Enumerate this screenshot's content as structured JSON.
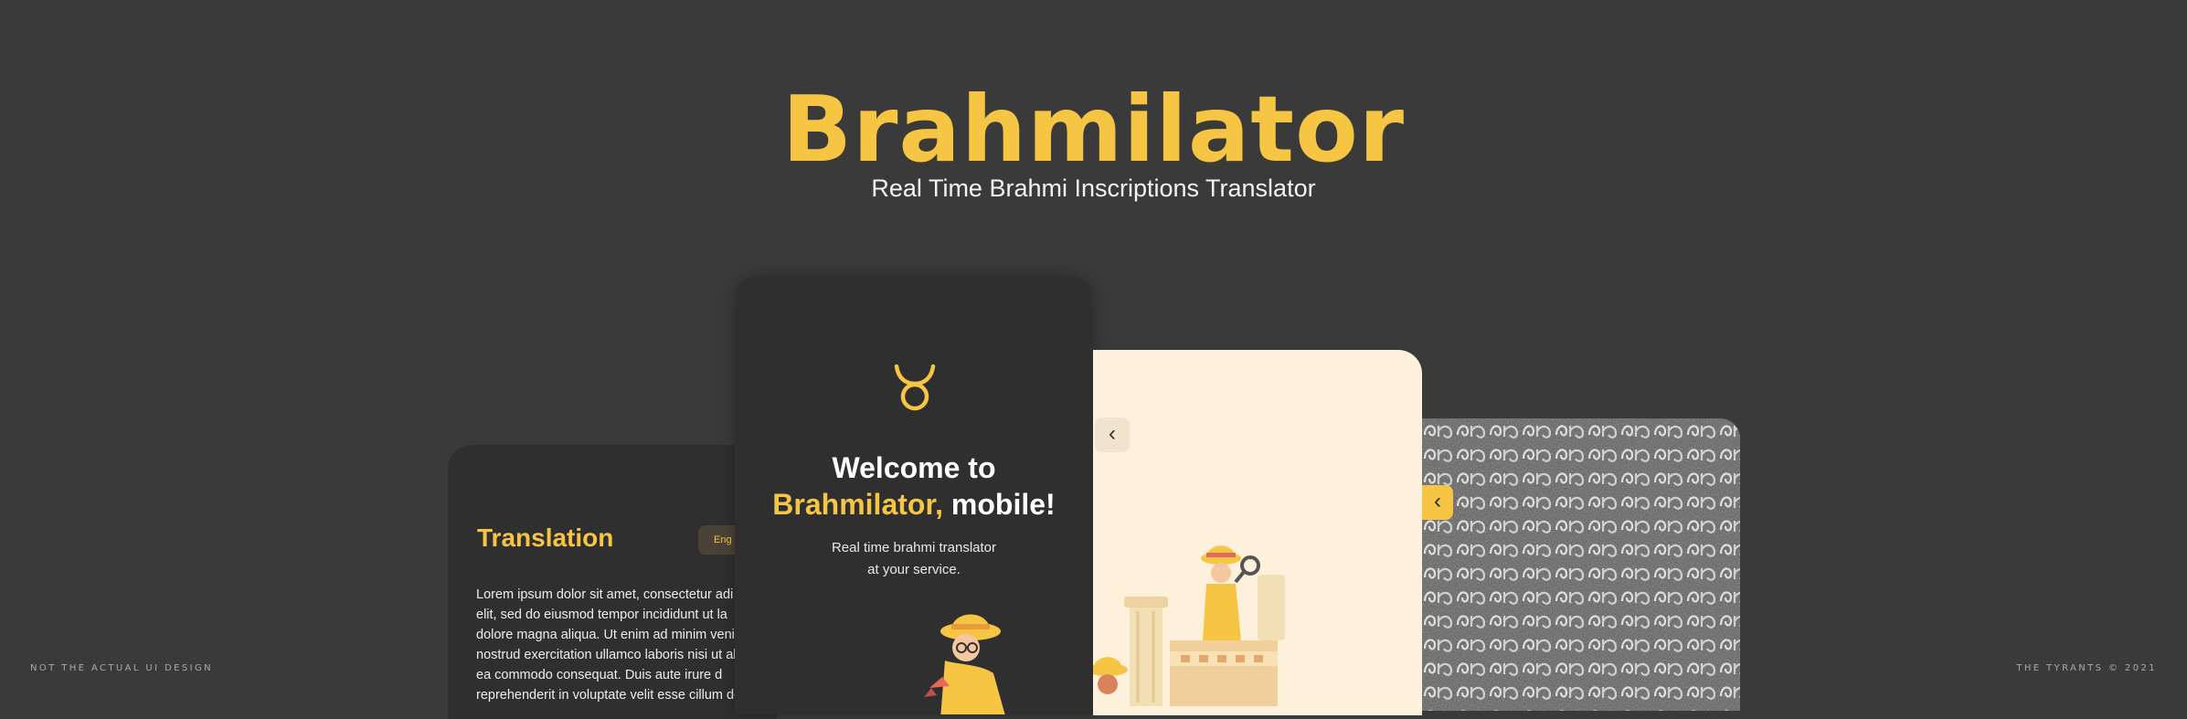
{
  "header": {
    "title": "Brahmilator",
    "subtitle": "Real Time Brahmi Inscriptions Translator"
  },
  "footer": {
    "left_note": "NOT THE ACTUAL UI DESIGN",
    "right_note": "THE TYRANTS © 2021"
  },
  "translation_screen": {
    "title": "Translation",
    "language_chip": "Eng",
    "body": "Lorem ipsum dolor sit amet, consectetur adi\nelit, sed do eiusmod tempor incididunt ut la\ndolore magna aliqua. Ut enim ad minim venia\nnostrud exercitation ullamco laboris nisi ut ali\nea commodo consequat. Duis aute irure d\nreprehenderit in voluptate velit esse cillum do"
  },
  "welcome_screen": {
    "title_line1": "Welcome to",
    "title_accent": "Brahmilator,",
    "title_rest": " mobile!",
    "subtitle": "Real time brahmi translator\nat your service.",
    "logo_icon": "taurus-icon"
  },
  "illustration_screen": {
    "back_icon": "chevron-left-icon"
  },
  "inscription_screen": {
    "back_icon": "chevron-left-icon"
  },
  "colors": {
    "background": "#3a3a3a",
    "card_dark": "#2f2f2f",
    "accent": "#f7c544",
    "cream": "#fdf1dc"
  }
}
